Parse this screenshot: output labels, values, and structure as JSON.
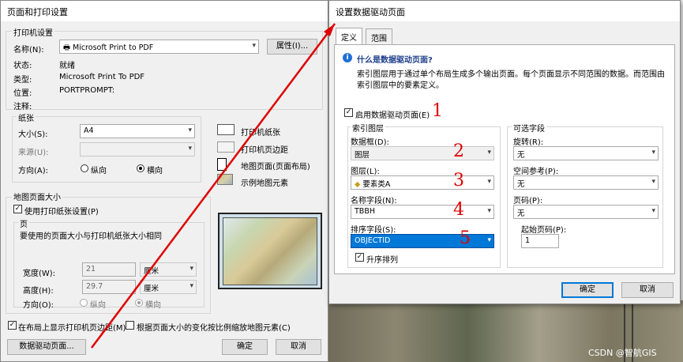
{
  "left_dialog": {
    "title": "页面和打印设置",
    "printer_group": "打印机设置",
    "name_label": "名称(N):",
    "printer_name": "Microsoft Print to PDF",
    "properties_button": "属性(I)...",
    "status_label": "状态:",
    "status_value": "就绪",
    "type_label": "类型:",
    "type_value": "Microsoft Print To PDF",
    "location_label": "位置:",
    "location_value": "PORTPROMPT:",
    "comment_label": "注释:",
    "paper_group": "纸张",
    "size_label": "大小(S):",
    "size_value": "A4",
    "source_label": "来源(U):",
    "source_value": "",
    "orientation_label": "方向(A):",
    "portrait": "纵向",
    "landscape": "横向",
    "map_page_group": "地图页面大小",
    "use_printer_paper": "使用打印纸张设置(P)",
    "page_group": "页",
    "page_note": "要使用的页面大小与打印机纸张大小相同",
    "width_label": "宽度(W):",
    "width_value": "21",
    "width_unit": "厘米",
    "height_label": "高度(H):",
    "height_value": "29.7",
    "height_unit": "厘米",
    "orientation2_label": "方向(O):",
    "portrait2": "纵向",
    "landscape2": "横向",
    "legend_printer_paper": "打印机纸张",
    "legend_printer_margin": "打印机页边距",
    "legend_map_page": "地图页面(页面布局)",
    "legend_sample": "示例地图元素",
    "show_margins": "在布局上显示打印机页边距(M)",
    "scale_elements": "根据页面大小的变化按比例缩放地图元素(C)",
    "ddp_button": "数据驱动页面...",
    "ok": "确定",
    "cancel": "取消"
  },
  "right_dialog": {
    "title": "设置数据驱动页面",
    "tab_define": "定义",
    "tab_extent": "范围",
    "info_title": "什么是数据驱动页面?",
    "info_text_1": "索引图层用于通过单个布局生成多个输出页面。每个页面显示不同范围的数据。而范围由",
    "info_text_2": "索引图层中的要素定义。",
    "enable": "启用数据驱动页面(E)",
    "index_group": "索引图层",
    "frame_label": "数据框(D):",
    "frame_value": "图层",
    "layer_label": "图层(L):",
    "layer_value": "要素类A",
    "name_field_label": "名称字段(N):",
    "name_field_value": "TBBH",
    "sort_field_label": "排序字段(S):",
    "sort_field_value": "OBJECTID",
    "ascending": "升序排列",
    "optional_group": "可选字段",
    "rotation_label": "旋转(R):",
    "rotation_value": "无",
    "spatial_ref_label": "空间参考(P):",
    "spatial_ref_value": "无",
    "page_num_label": "页码(P):",
    "page_num_value": "无",
    "start_page_label": "起始页码(P):",
    "start_page_value": "1",
    "ok": "确定",
    "cancel": "取消"
  },
  "annotations": [
    "1",
    "2",
    "3",
    "4",
    "5"
  ],
  "watermark": "CSDN @智航GIS"
}
